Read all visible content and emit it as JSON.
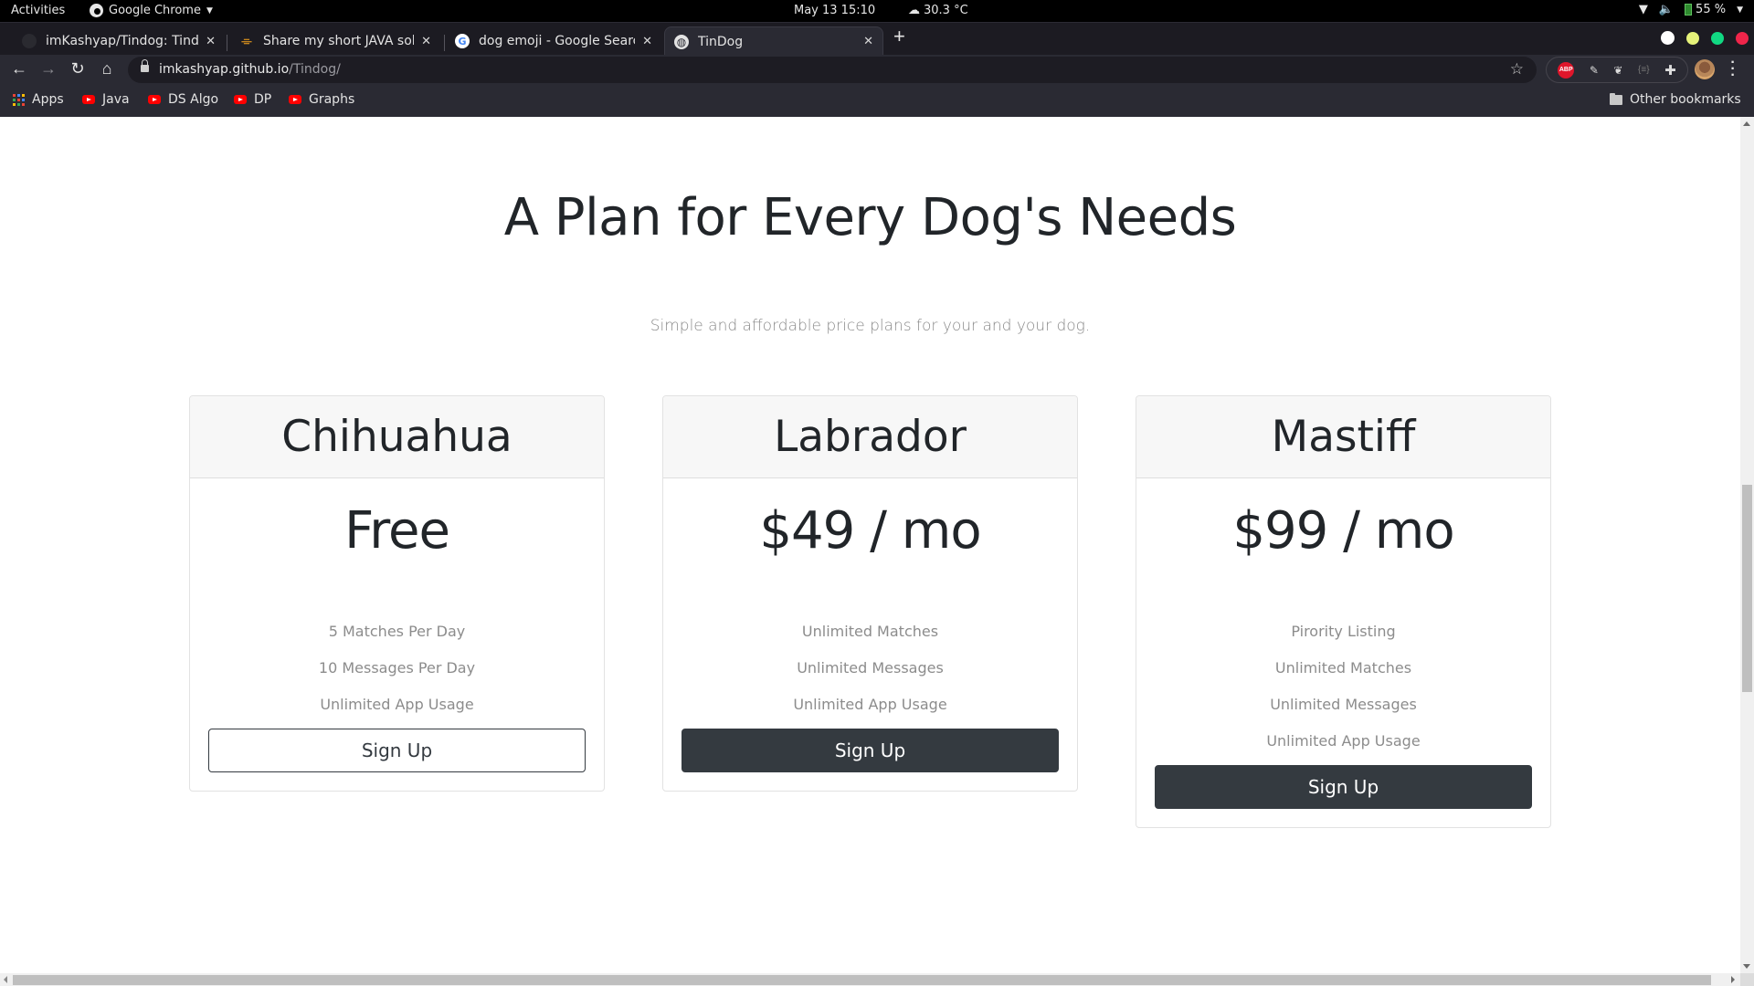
{
  "system_bar": {
    "activities": "Activities",
    "app_name": "Google Chrome",
    "datetime": "May 13  15:10",
    "weather": "30.3 °C",
    "battery": "55 %"
  },
  "browser": {
    "tabs": [
      {
        "title": "imKashyap/Tindog: Tindog",
        "favicon": "github-icon",
        "active": false
      },
      {
        "title": "Share my short JAVA solution",
        "favicon": "leetcode-icon",
        "active": false
      },
      {
        "title": "dog emoji - Google Search",
        "favicon": "google-icon",
        "active": false
      },
      {
        "title": "TinDog",
        "favicon": "globe-icon",
        "active": true
      }
    ],
    "new_tab": "+",
    "url_host": "imkashyap.github.io",
    "url_path": "/Tindog/",
    "extensions": [
      "adblock-plus",
      "color-picker",
      "gnome-shell-integration",
      "json-viewer",
      "extensions"
    ],
    "abp_label": "ABP",
    "bookmarks": [
      {
        "label": "Apps",
        "icon": "apps-grid-icon"
      },
      {
        "label": "Java",
        "icon": "youtube-icon"
      },
      {
        "label": "DS Algo",
        "icon": "youtube-icon"
      },
      {
        "label": "DP",
        "icon": "youtube-icon"
      },
      {
        "label": "Graphs",
        "icon": "youtube-icon"
      }
    ],
    "other_bookmarks": "Other bookmarks",
    "window_control_colors": {
      "minimize": "#e6f27a",
      "maximize": "#11d983",
      "close": "#f0254a"
    }
  },
  "page": {
    "heading": "A Plan for Every Dog's Needs",
    "subtitle": "Simple and affordable price plans for your and your dog.",
    "plans": [
      {
        "name": "Chihuahua",
        "price": "Free",
        "features": [
          "5 Matches Per Day",
          "10 Messages Per Day",
          "Unlimited App Usage"
        ],
        "button": "Sign Up",
        "button_style": "outline"
      },
      {
        "name": "Labrador",
        "price": "$49 / mo",
        "features": [
          "Unlimited Matches",
          "Unlimited Messages",
          "Unlimited App Usage"
        ],
        "button": "Sign Up",
        "button_style": "dark"
      },
      {
        "name": "Mastiff",
        "price": "$99 / mo",
        "features": [
          "Pirority Listing",
          "Unlimited Matches",
          "Unlimited Messages",
          "Unlimited App Usage"
        ],
        "button": "Sign Up",
        "button_style": "dark"
      }
    ],
    "colors": {
      "text": "#212529",
      "muted": "#8c8c8c",
      "button_dark": "#343a40",
      "card_header": "#f7f7f7"
    }
  },
  "scroll": {
    "vertical_position": 0.57,
    "vertical_visible_fraction": 0.25
  }
}
